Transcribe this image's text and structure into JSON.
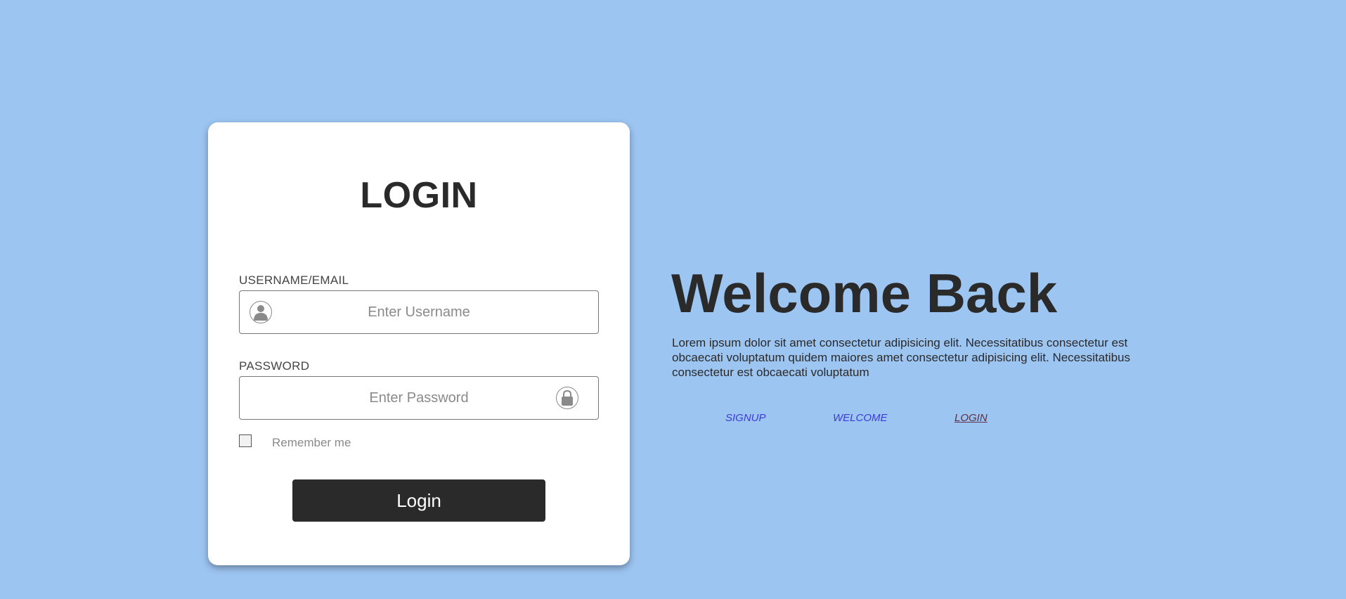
{
  "login_card": {
    "title": "LOGIN",
    "username": {
      "label": "USERNAME/EMAIL",
      "placeholder": "Enter Username",
      "value": "",
      "icon": "user-icon"
    },
    "password": {
      "label": "PASSWORD",
      "placeholder": "Enter Password",
      "value": "",
      "icon": "lock-icon"
    },
    "remember_label": "Remember me",
    "remember_checked": false,
    "button_label": "Login"
  },
  "welcome": {
    "title": "Welcome Back",
    "text": "Lorem ipsum dolor sit amet consectetur adipisicing elit. Necessitatibus consectetur est obcaecati voluptatum quidem maiores amet consectetur adipisicing elit. Necessitatibus consectetur est obcaecati voluptatum"
  },
  "nav": {
    "items": [
      {
        "label": "SIGNUP",
        "active": false
      },
      {
        "label": "WELCOME",
        "active": false
      },
      {
        "label": "LOGIN",
        "active": true
      }
    ]
  },
  "colors": {
    "background": "#9dc5f2",
    "card": "#ffffff",
    "text_dark": "#2a2a2a",
    "link": "#3b3bdb",
    "link_active": "#5a3048",
    "button_bg": "#2a2a2a"
  }
}
